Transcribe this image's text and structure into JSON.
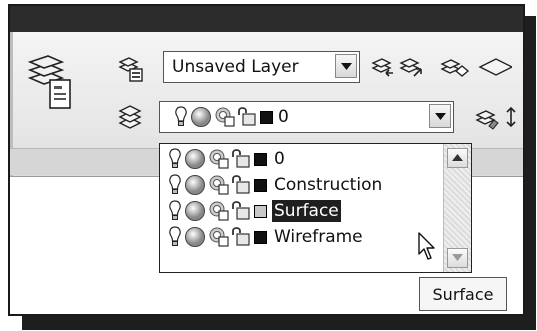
{
  "layer_panel": {
    "current_layer": "Unsaved Layer",
    "active_layer": "0",
    "swatch_colors": {
      "black": "#111111",
      "light_gray": "#c8c8c8"
    }
  },
  "dropdown": {
    "items": [
      {
        "label": "0",
        "swatch": "#111111",
        "selected": false
      },
      {
        "label": "Construction",
        "swatch": "#111111",
        "selected": false
      },
      {
        "label": "Surface",
        "swatch": "#c8c8c8",
        "selected": true
      },
      {
        "label": "Wireframe",
        "swatch": "#111111",
        "selected": false
      }
    ]
  },
  "tooltip": {
    "text": "Surface"
  }
}
